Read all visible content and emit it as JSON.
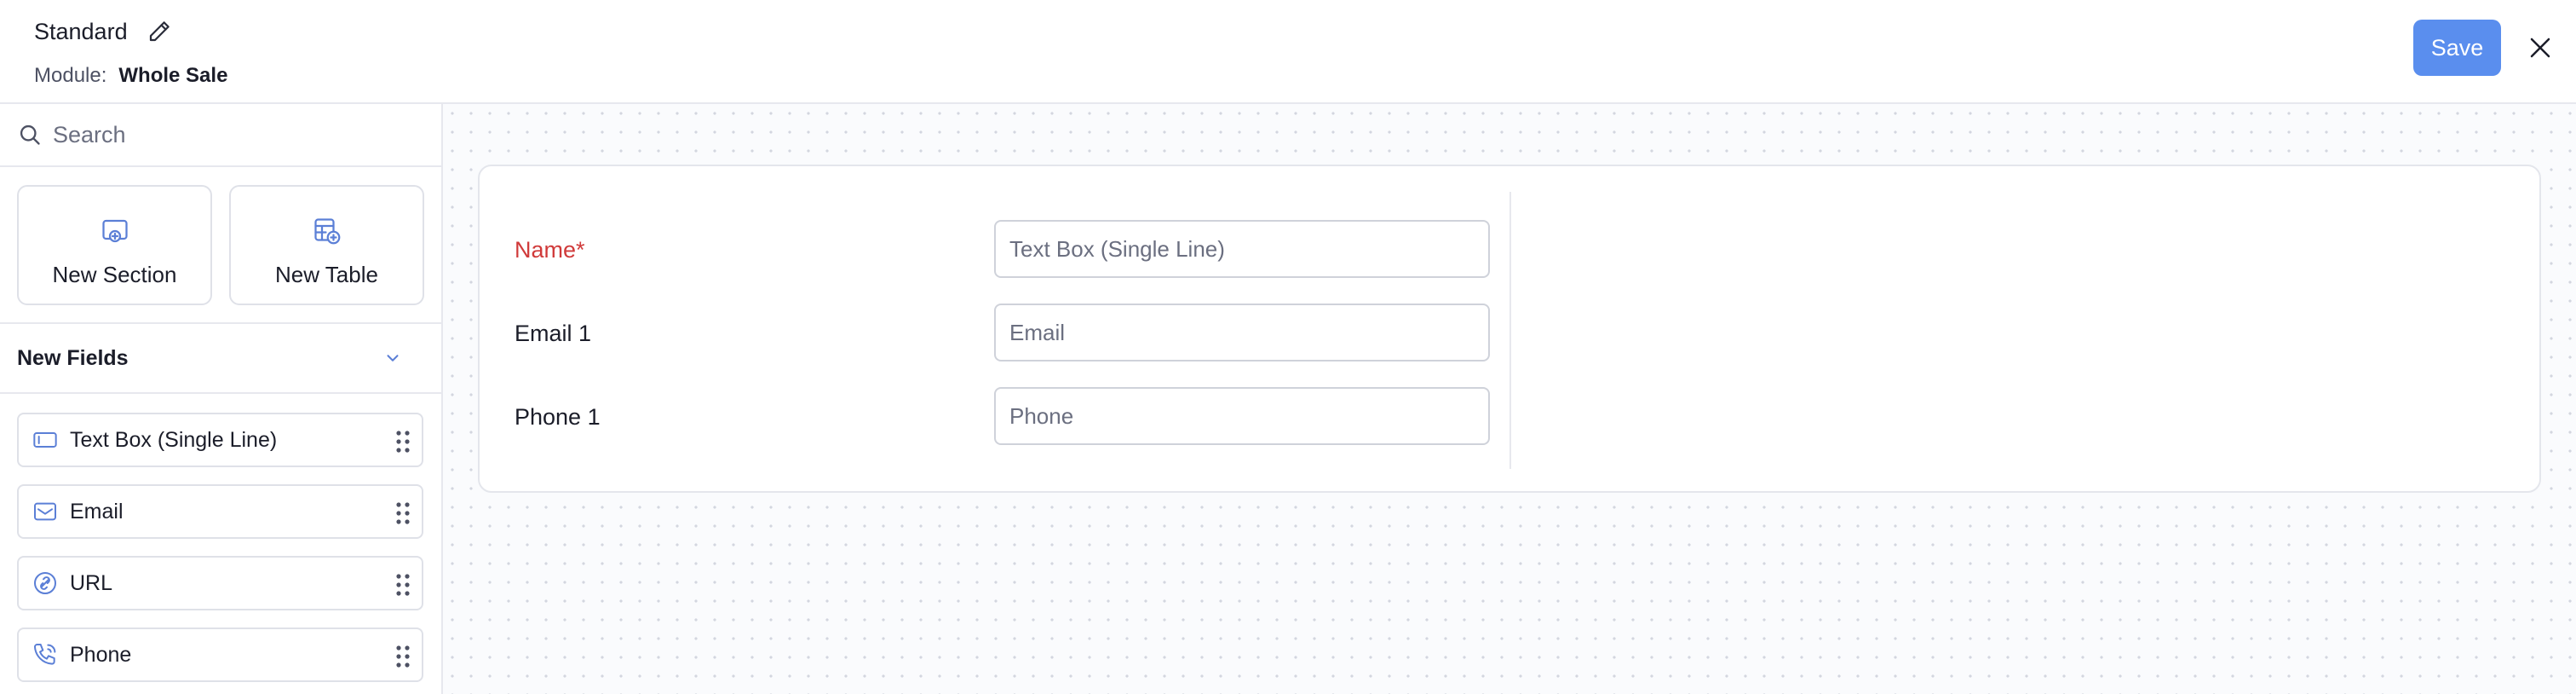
{
  "header": {
    "title": "Standard",
    "module_label": "Module:",
    "module_value": "Whole Sale",
    "save_label": "Save"
  },
  "sidebar": {
    "search_placeholder": "Search",
    "tiles": [
      {
        "label": "New Section",
        "icon": "new-section-icon"
      },
      {
        "label": "New Table",
        "icon": "new-table-icon"
      }
    ],
    "new_fields_title": "New Fields",
    "fields": [
      {
        "label": "Text Box (Single Line)",
        "icon": "text-box-icon"
      },
      {
        "label": "Email",
        "icon": "envelope-icon"
      },
      {
        "label": "URL",
        "icon": "link-icon"
      },
      {
        "label": "Phone",
        "icon": "phone-icon"
      }
    ]
  },
  "form": {
    "rows": [
      {
        "label": "Name*",
        "placeholder": "Text Box (Single Line)",
        "required": true
      },
      {
        "label": "Email 1",
        "placeholder": "Email",
        "required": false
      },
      {
        "label": "Phone 1",
        "placeholder": "Phone",
        "required": false
      }
    ]
  },
  "colors": {
    "accent": "#5a8eee",
    "required": "#d03a3a",
    "icon_blue": "#5b7fd6",
    "border": "#e7e8ee"
  }
}
